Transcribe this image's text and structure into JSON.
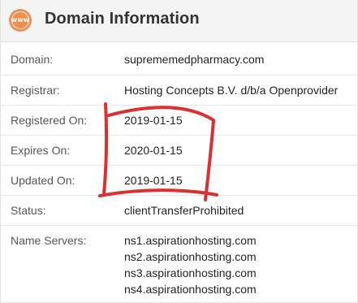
{
  "header": {
    "icon_text": "www",
    "icon_name": "www-globe-icon",
    "title": "Domain Information",
    "accent_color": "#ee8e4f"
  },
  "rows": [
    {
      "label": "Domain:",
      "value": "suprememedpharmacy.com"
    },
    {
      "label": "Registrar:",
      "value": "Hosting Concepts B.V. d/b/a Openprovider"
    },
    {
      "label": "Registered On:",
      "value": "2019-01-15"
    },
    {
      "label": "Expires On:",
      "value": "2020-01-15"
    },
    {
      "label": "Updated On:",
      "value": "2019-01-15"
    },
    {
      "label": "Status:",
      "value": "clientTransferProhibited"
    }
  ],
  "name_servers": {
    "label": "Name Servers:",
    "values": [
      "ns1.aspirationhosting.com",
      "ns2.aspirationhosting.com",
      "ns3.aspirationhosting.com",
      "ns4.aspirationhosting.com"
    ]
  },
  "annotation": {
    "type": "hand-drawn-box",
    "color": "#d93030"
  }
}
